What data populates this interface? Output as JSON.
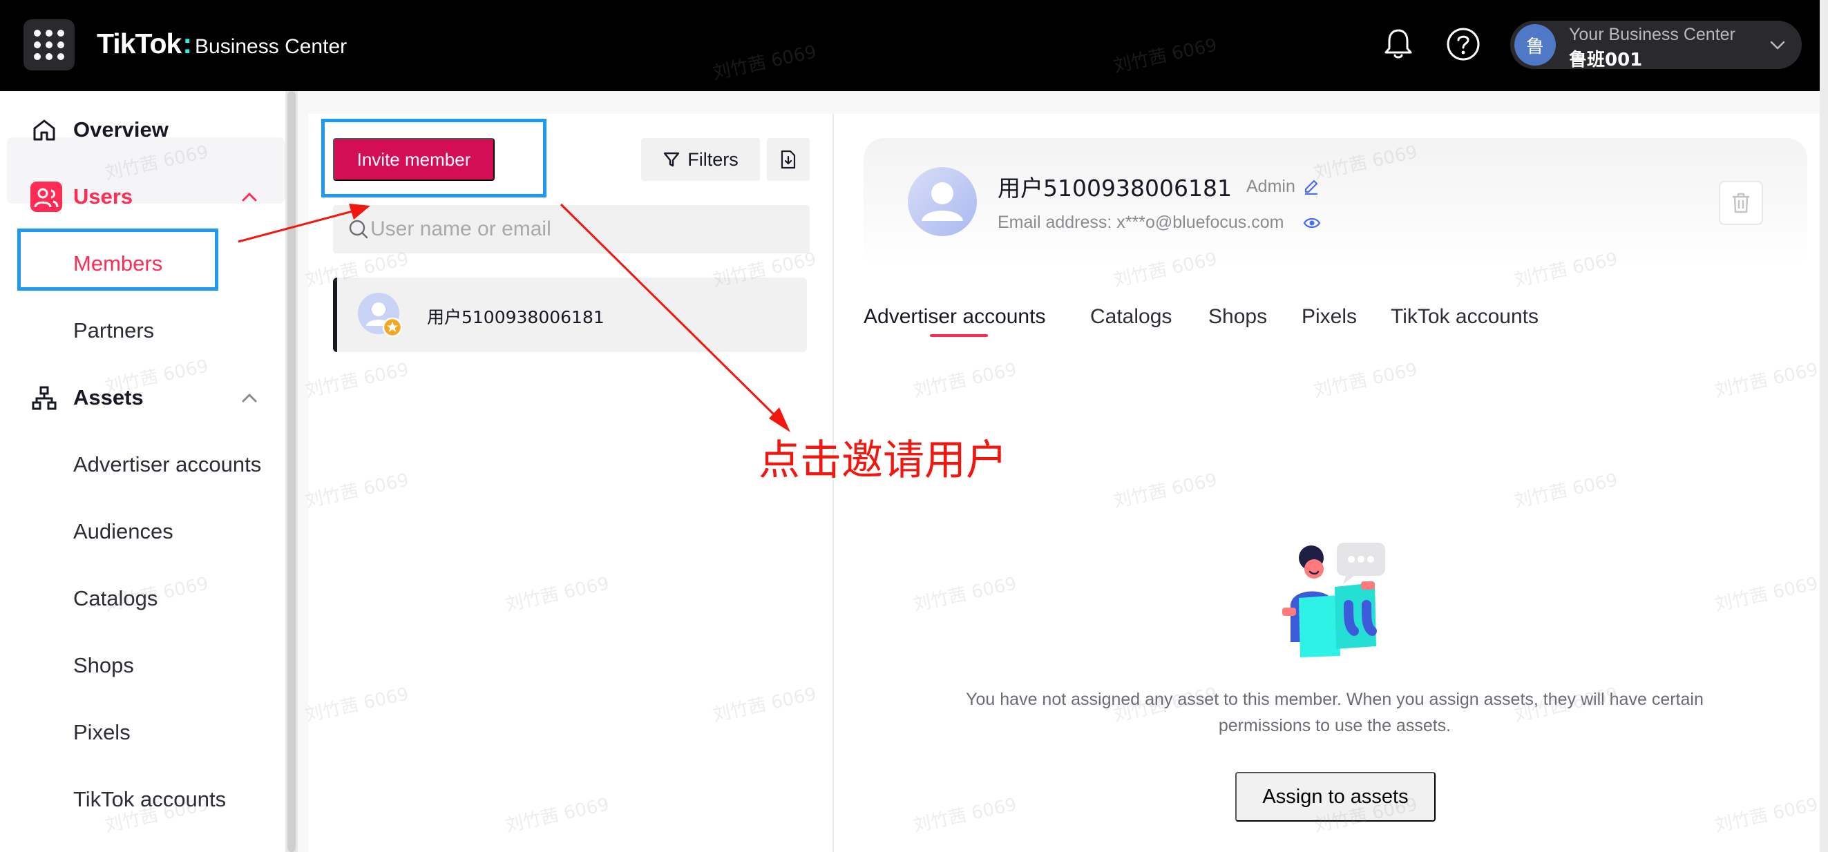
{
  "topbar": {
    "brand": "TikTok",
    "brand_dot": ":",
    "product": "Business Center",
    "account_title": "Your Business Center",
    "account_name": "鲁班001",
    "account_avatar_char": "鲁"
  },
  "sidebar": {
    "overview": "Overview",
    "users": "Users",
    "members": "Members",
    "partners": "Partners",
    "assets": "Assets",
    "asset_items": [
      "Advertiser accounts",
      "Audiences",
      "Catalogs",
      "Shops",
      "Pixels",
      "TikTok accounts"
    ]
  },
  "members_list": {
    "invite_label": "Invite member",
    "filters_label": "Filters",
    "search_placeholder": "User name or email",
    "items": [
      {
        "name": "用户5100938006181"
      }
    ]
  },
  "detail": {
    "name": "用户5100938006181",
    "role": "Admin",
    "email": "Email address: x***o@bluefocus.com",
    "tabs": [
      "Advertiser accounts",
      "Catalogs",
      "Shops",
      "Pixels",
      "TikTok accounts"
    ],
    "active_tab": "Advertiser accounts",
    "empty_message": "You have not assigned any asset to this member. When you assign assets, they will have certain permissions to use the assets.",
    "assign_label": "Assign to assets"
  },
  "annotation": {
    "text": "点击邀请用户"
  },
  "watermark": "刘竹茜 6069",
  "colors": {
    "accent": "#fe2c55",
    "invite": "#d40e55",
    "annotation_box": "#1e9af5",
    "annotation_arrow": "#f2160f"
  }
}
